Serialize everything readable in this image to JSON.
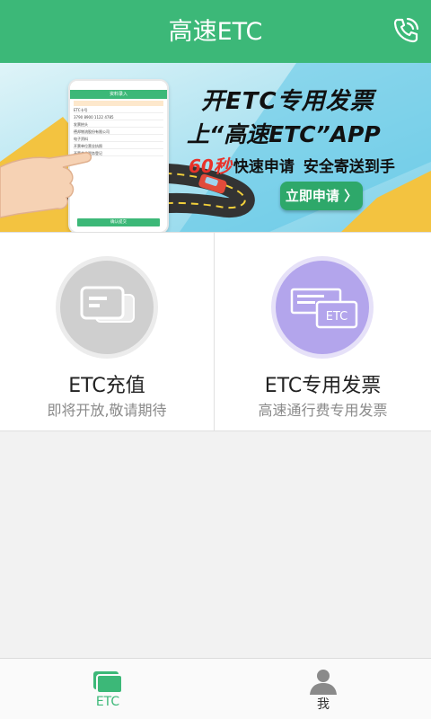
{
  "header": {
    "title": "高速ETC",
    "phone_icon": "phone-icon"
  },
  "banner": {
    "line1": "开ETC专用发票",
    "line2": "上“高速ETC”APP",
    "highlight": "60秒",
    "slogan_a": "快速申请",
    "slogan_b": "安全寄送到手",
    "apply_label": "立即申请 〉",
    "mock": {
      "title": "资料录入",
      "field_label": "ETC卡号",
      "card_number": "3790 8900 1122 4785",
      "invoice_label": "发票抬头",
      "company": "德邦物流股份有限公司",
      "section": "电子资料",
      "item1": "开票单位营业执照",
      "item2": "开票单位税务登记",
      "submit": "确认提交"
    }
  },
  "cards": [
    {
      "title": "ETC充值",
      "subtitle": "即将开放,敬请期待",
      "icon": "card-stack-icon"
    },
    {
      "title": "ETC专用发票",
      "subtitle": "高速通行费专用发票",
      "icon": "etc-invoice-icon"
    }
  ],
  "tabbar": {
    "tabs": [
      {
        "label": "ETC",
        "icon": "etc-cards-icon",
        "active": true
      },
      {
        "label": "我",
        "icon": "user-icon",
        "active": false
      }
    ]
  },
  "colors": {
    "primary": "#3cb878",
    "invoice_icon": "#b3a5ec",
    "recharge_icon": "#cfcfcf"
  }
}
